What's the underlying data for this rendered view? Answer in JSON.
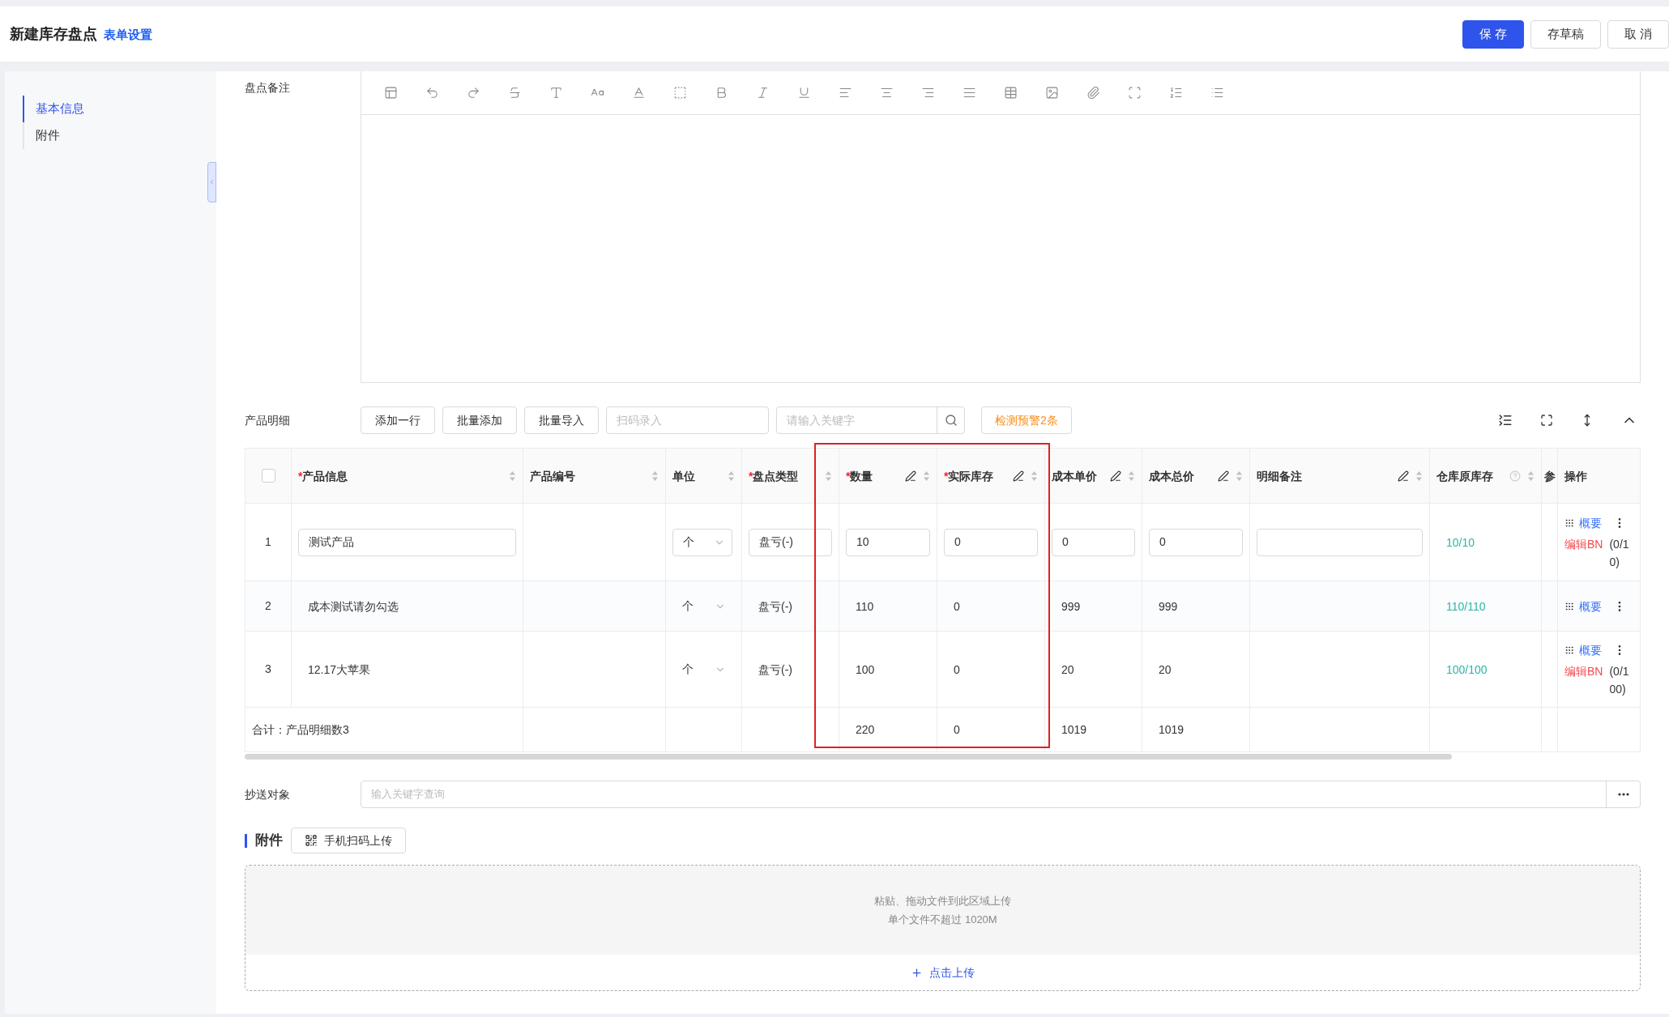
{
  "header": {
    "title": "新建库存盘点",
    "settings_link": "表单设置",
    "buttons": [
      {
        "label": "保 存",
        "kind": "primary"
      },
      {
        "label": "存草稿",
        "kind": "default"
      },
      {
        "label": "取 消",
        "kind": "default"
      }
    ]
  },
  "sidebar": {
    "items": [
      {
        "label": "基本信息",
        "selected": true
      },
      {
        "label": "附件",
        "selected": false
      }
    ]
  },
  "remarks": {
    "label": "盘点备注"
  },
  "products": {
    "label": "产品明细",
    "buttons": [
      "添加一行",
      "批量添加",
      "批量导入"
    ],
    "scan": {
      "placeholder": "扫码录入"
    },
    "search": {
      "placeholder": "请输入关键字"
    },
    "warning_button": "检测预警2条",
    "table": {
      "select_all_checked": false,
      "columns": [
        {
          "label": "产品信息",
          "required_mark": "*",
          "editable": false,
          "sortable": true
        },
        {
          "label": "产品编号",
          "editable": false,
          "sortable": true
        },
        {
          "label": "单位",
          "editable": false,
          "sortable": true
        },
        {
          "label": "盘点类型",
          "required_mark": "*",
          "editable": false,
          "sortable": true
        },
        {
          "label": "数量",
          "required_mark": "*",
          "editable": true,
          "sortable": true
        },
        {
          "label": "实际库存",
          "required_mark": "*",
          "editable": true,
          "sortable": true
        },
        {
          "label": "成本单价",
          "editable": true,
          "sortable": true
        },
        {
          "label": "成本总价",
          "editable": true,
          "sortable": true
        },
        {
          "label": "明细备注",
          "editable": true,
          "sortable": true
        },
        {
          "label": "仓库原库存",
          "editable": false,
          "sortable": true,
          "help": true
        },
        {
          "label": "参"
        },
        {
          "label": "操作",
          "editable": false,
          "sortable": false
        }
      ],
      "rows": [
        {
          "index": "1",
          "cells": [
            {
              "kind": "input",
              "value": "测试产品"
            },
            {
              "kind": "blank"
            },
            {
              "kind": "select",
              "value": "个"
            },
            {
              "kind": "input",
              "value": "盘亏(-)"
            },
            {
              "kind": "input",
              "value": "10"
            },
            {
              "kind": "input",
              "value": "0"
            },
            {
              "kind": "input",
              "value": "0"
            },
            {
              "kind": "input",
              "value": "0"
            },
            {
              "kind": "input"
            },
            {
              "kind": "stock",
              "text": "10/10"
            },
            {
              "kind": "blank"
            },
            {
              "kind": "actions",
              "summary": "概要",
              "edit": "编辑BN",
              "count": "(0/10)"
            }
          ]
        },
        {
          "index": "2",
          "cells": [
            {
              "kind": "text",
              "text": "成本测试请勿勾选"
            },
            {
              "kind": "blank"
            },
            {
              "kind": "plain_select",
              "value": "个"
            },
            {
              "kind": "text",
              "text": "盘亏(-)"
            },
            {
              "kind": "text",
              "text": "110"
            },
            {
              "kind": "text",
              "text": "0"
            },
            {
              "kind": "text",
              "text": "999"
            },
            {
              "kind": "text",
              "text": "999"
            },
            {
              "kind": "blank"
            },
            {
              "kind": "stock",
              "text": "110/110"
            },
            {
              "kind": "blank"
            },
            {
              "kind": "actions",
              "summary": "概要"
            }
          ]
        },
        {
          "index": "3",
          "cells": [
            {
              "kind": "text",
              "text": "12.17大苹果"
            },
            {
              "kind": "blank"
            },
            {
              "kind": "plain_select",
              "value": "个"
            },
            {
              "kind": "text",
              "text": "盘亏(-)"
            },
            {
              "kind": "text",
              "text": "100"
            },
            {
              "kind": "text",
              "text": "0"
            },
            {
              "kind": "text",
              "text": "20"
            },
            {
              "kind": "text",
              "text": "20"
            },
            {
              "kind": "blank"
            },
            {
              "kind": "stock",
              "text": "100/100"
            },
            {
              "kind": "blank"
            },
            {
              "kind": "actions",
              "summary": "概要",
              "edit": "编辑BN",
              "count": "(0/100)"
            }
          ]
        }
      ],
      "totals": {
        "label": "合计：产品明细数3",
        "cells": [
          {
            "kind": "blank"
          },
          {
            "kind": "blank"
          },
          {
            "kind": "blank"
          },
          {
            "kind": "text",
            "text": "220"
          },
          {
            "kind": "text",
            "text": "0"
          },
          {
            "kind": "text",
            "text": "1019"
          },
          {
            "kind": "text",
            "text": "1019"
          },
          {
            "kind": "blank"
          },
          {
            "kind": "blank"
          },
          {
            "kind": "blank"
          },
          {
            "kind": "blank"
          }
        ]
      }
    }
  },
  "cc": {
    "label": "抄送对象",
    "placeholder": "输入关键字查询"
  },
  "attachments": {
    "title": "附件",
    "scan_button": "手机扫码上传",
    "drop_hint": "粘贴、拖动文件到此区域上传",
    "limit": "单个文件不超过 1020M",
    "upload_link": "点击上传"
  }
}
